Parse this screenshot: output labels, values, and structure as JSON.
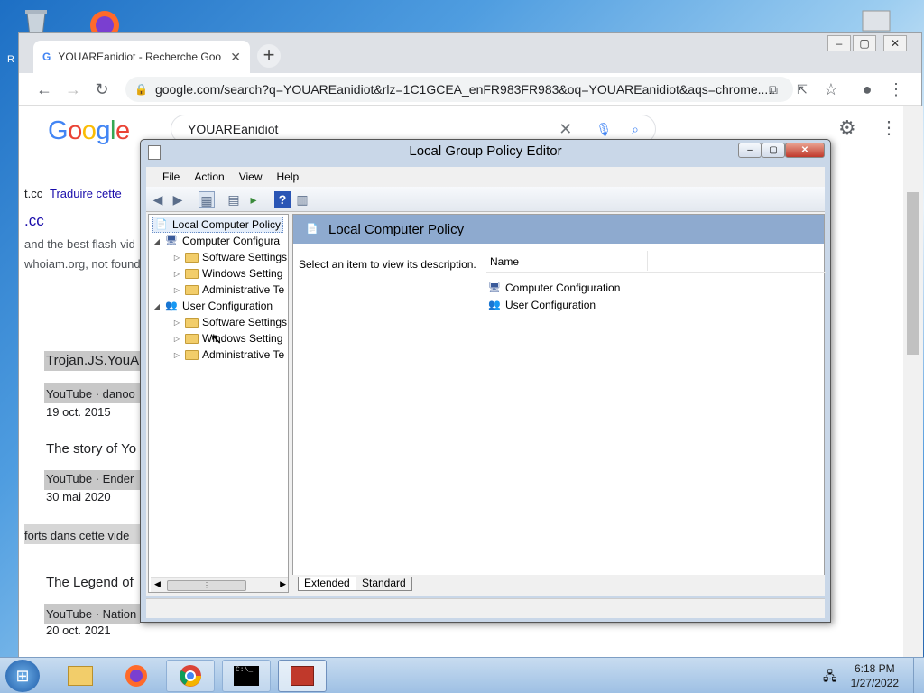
{
  "desktop": {
    "icons": [
      "recycle-bin-icon",
      "firefox-icon",
      "desktop-shortcut-icon"
    ],
    "partial_label": "R"
  },
  "chrome": {
    "tab_title": "YOUAREanidiot - Recherche Goo",
    "url": "google.com/search?q=YOUAREanidiot&rlz=1C1GCEA_enFR983FR983&oq=YOUAREanidiot&aqs=chrome.....",
    "search_query": "YOUAREanidiot",
    "logo": "Google",
    "results": {
      "cc_link": "t.cc",
      "translate": "Traduire cette",
      "cc_title": ".cc",
      "snippet1": "and the best flash vid",
      "snippet2": "whoiam.org, not found",
      "r1_title": "Trojan.JS.YouA",
      "r1_meta": "YouTube · danoo",
      "r1_date": "19 oct. 2015",
      "r2_title": "The story of Yo",
      "r2_meta": "YouTube · Ender",
      "r2_date": "30 mai 2020",
      "snippet3": "forts dans cette vide",
      "r3_title": "The Legend of",
      "r3_meta": "YouTube · Nation",
      "r3_date": "20 oct. 2021"
    }
  },
  "gpe": {
    "title": "Local Group Policy Editor",
    "menu": [
      "File",
      "Action",
      "View",
      "Help"
    ],
    "tree": {
      "root": "Local Computer Policy",
      "computer": "Computer Configura",
      "computer_children": [
        "Software Settings",
        "Windows Setting",
        "Administrative Te"
      ],
      "user": "User Configuration",
      "user_children": [
        "Software Settings",
        "Windows Setting",
        "Administrative Te"
      ]
    },
    "right_header": "Local Computer Policy",
    "description": "Select an item to view its description.",
    "column_name": "Name",
    "items": [
      "Computer Configuration",
      "User Configuration"
    ],
    "tabs": [
      "Extended",
      "Standard"
    ]
  },
  "taskbar": {
    "time": "6:18 PM",
    "date": "1/27/2022"
  }
}
